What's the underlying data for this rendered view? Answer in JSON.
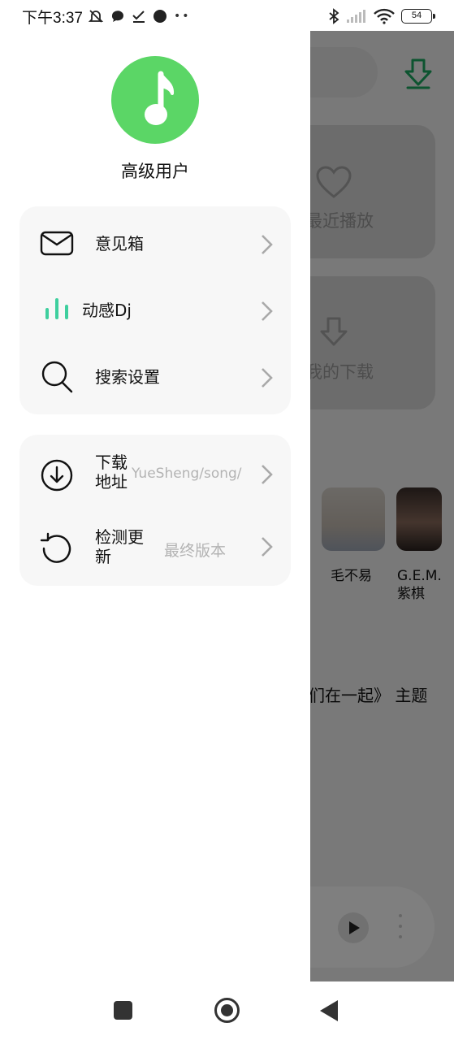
{
  "status_bar": {
    "time": "下午3:37",
    "battery": "54"
  },
  "background_app": {
    "cards": [
      {
        "label": "最近播放",
        "icon": "heart-icon"
      },
      {
        "label": "我的下载",
        "icon": "download-icon"
      }
    ],
    "artists": [
      {
        "name": "毛不易"
      },
      {
        "name": "G.E.M.\n紫棋"
      }
    ],
    "theme_text": "们在一起》 主题"
  },
  "drawer": {
    "user": {
      "name": "高级用户",
      "avatar_icon": "music-note-icon",
      "avatar_color": "#5bd666"
    },
    "group1": [
      {
        "label": "意见箱",
        "icon": "mail-icon"
      },
      {
        "label": "动感Dj",
        "icon": "equalizer-icon"
      },
      {
        "label": "搜索设置",
        "icon": "search-icon"
      }
    ],
    "group2": [
      {
        "label": "下载\n地址",
        "value": "YueSheng/song/",
        "icon": "download-circle-icon"
      },
      {
        "label": "检测更\n新",
        "value": "最终版本",
        "icon": "refresh-icon"
      }
    ]
  },
  "colors": {
    "accent_green": "#5bd666",
    "equalizer_teal": "#3ecf9e"
  }
}
